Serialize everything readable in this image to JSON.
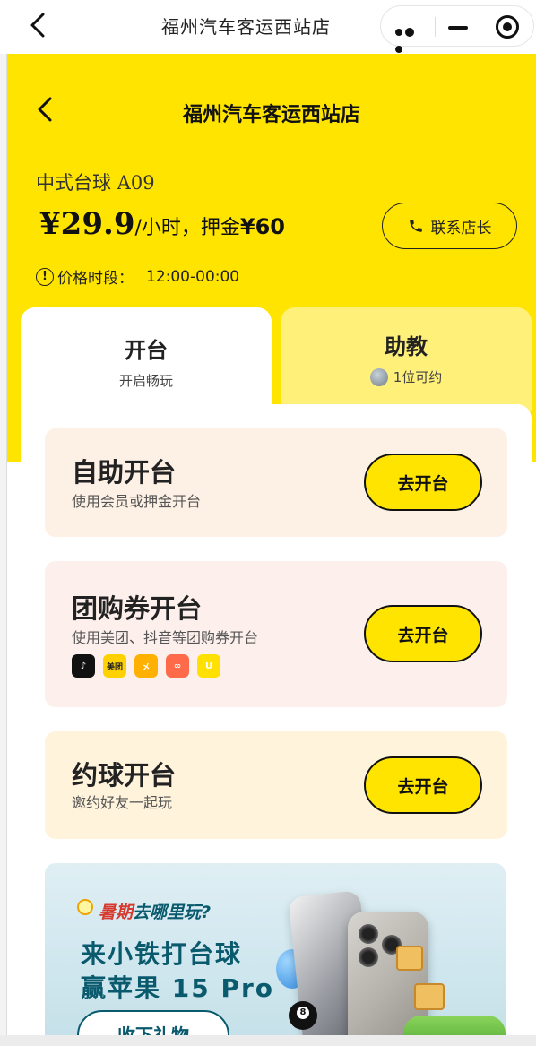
{
  "window": {
    "title": "福州汽车客运西站店"
  },
  "capsule": {
    "more_icon": "more-dots-icon",
    "minimize_icon": "minimize-icon",
    "close_icon": "target-close-icon"
  },
  "header": {
    "title": "福州汽车客运西站店"
  },
  "table": {
    "name": "中式台球 A09",
    "price_symbol": "¥",
    "price": "29.9",
    "price_unit": "/小时，押金",
    "deposit": "¥60",
    "contact_label": "联系店长",
    "time_label": "价格时段：",
    "time_range": "12:00-00:00"
  },
  "tabs": [
    {
      "label": "开台",
      "sub": "开启畅玩"
    },
    {
      "label": "助教",
      "sub": "1位可约"
    }
  ],
  "cards": [
    {
      "title": "自助开台",
      "subtitle": "使用会员或押金开台",
      "button": "去开台"
    },
    {
      "title": "团购券开台",
      "subtitle": "使用美团、抖音等团购券开台",
      "button": "去开台"
    },
    {
      "title": "约球开台",
      "subtitle": "邀约好友一起玩",
      "button": "去开台"
    }
  ],
  "platforms": [
    {
      "icon": "douyin-icon",
      "glyph": "♪"
    },
    {
      "icon": "meituan-icon",
      "glyph": "美团"
    },
    {
      "icon": "platform-a-icon",
      "glyph": "㐅"
    },
    {
      "icon": "platform-b-icon",
      "glyph": "∞"
    },
    {
      "icon": "platform-c-icon",
      "glyph": "U"
    }
  ],
  "banner": {
    "tag_prefix": "暑期",
    "tag_highlight": "去哪里玩?",
    "line1": "来小铁打台球",
    "line2": "赢苹果 15 Pro",
    "button": "收下礼物"
  },
  "colors": {
    "accent_yellow": "#ffe400",
    "coach_tab": "#fff07a",
    "card1_bg": "#fdf0e4",
    "card2_bg": "#fdf0ec",
    "card3_bg": "#fff3dc"
  }
}
